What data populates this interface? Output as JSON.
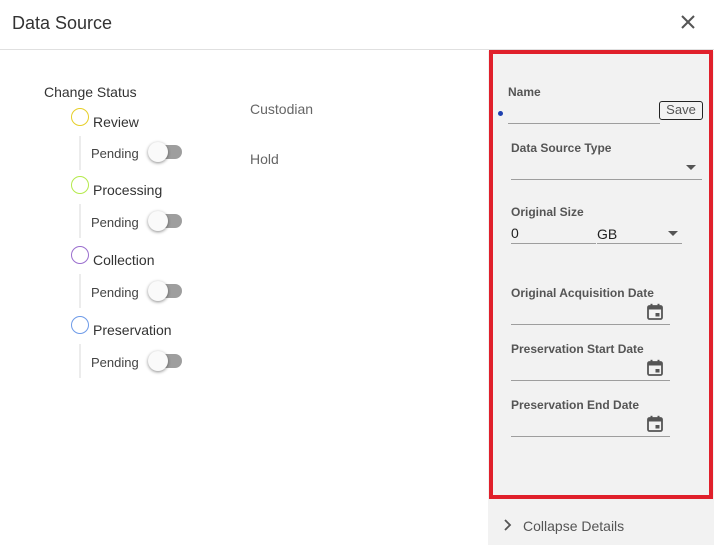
{
  "dialog": {
    "title": "Data Source",
    "close_icon": "close-icon"
  },
  "status": {
    "heading": "Change Status",
    "stages": [
      {
        "label": "Review",
        "state": "Pending",
        "color": "#e6cf2a",
        "toggle_on": false
      },
      {
        "label": "Processing",
        "state": "Pending",
        "color": "#b5ea4d",
        "toggle_on": false
      },
      {
        "label": "Collection",
        "state": "Pending",
        "color": "#9b6fce",
        "toggle_on": false
      },
      {
        "label": "Preservation",
        "state": "Pending",
        "color": "#6e9be8",
        "toggle_on": false
      }
    ]
  },
  "meta": {
    "custodian_label": "Custodian",
    "hold_label": "Hold"
  },
  "details": {
    "name_label": "Name",
    "name_value": "",
    "save_label": "Save",
    "data_source_type_label": "Data Source Type",
    "data_source_type_value": "",
    "original_size_label": "Original Size",
    "original_size_value": "0",
    "size_unit": "GB",
    "acquisition_date_label": "Original Acquisition Date",
    "preservation_start_label": "Preservation Start Date",
    "preservation_end_label": "Preservation End Date",
    "collapse_label": "Collapse Details"
  },
  "colors": {
    "highlight": "#e0202b",
    "panel_bg": "#f2f2f2",
    "focus_dot": "#1e40af"
  }
}
